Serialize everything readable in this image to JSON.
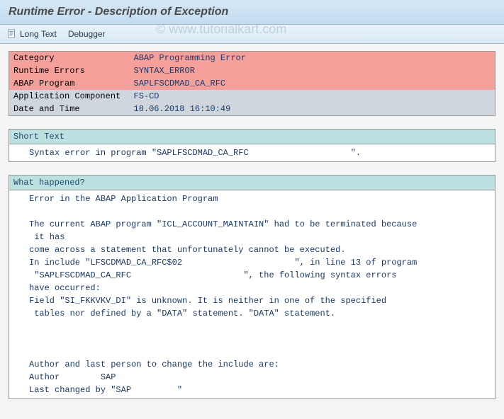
{
  "header": {
    "title": "Runtime Error - Description of Exception"
  },
  "toolbar": {
    "longtext_label": "Long Text",
    "debugger_label": "Debugger"
  },
  "info": {
    "rows": [
      {
        "label": "Category",
        "value": "ABAP Programming Error",
        "style": "red"
      },
      {
        "label": "Runtime Errors",
        "value": "SYNTAX_ERROR",
        "style": "red"
      },
      {
        "label": "ABAP Program",
        "value": "SAPLFSCDMAD_CA_RFC",
        "style": "red"
      },
      {
        "label": "Application Component",
        "value": "FS-CD",
        "style": "grey"
      },
      {
        "label": "Date and Time",
        "value": "18.06.2018 16:10:49",
        "style": "grey"
      }
    ]
  },
  "shorttext": {
    "header": "Short Text",
    "body": "Syntax error in program \"SAPLFSCDMAD_CA_RFC                    \"."
  },
  "whathappened": {
    "header": "What happened?",
    "body": "Error in the ABAP Application Program\n\nThe current ABAP program \"ICL_ACCOUNT_MAINTAIN\" had to be terminated because\n it has\ncome across a statement that unfortunately cannot be executed.\nIn include \"LFSCDMAD_CA_RFC$02                      \", in line 13 of program\n \"SAPLFSCDMAD_CA_RFC                      \", the following syntax errors\nhave occurred:\nField \"SI_FKKVKV_DI\" is unknown. It is neither in one of the specified\n tables nor defined by a \"DATA\" statement. \"DATA\" statement.\n\n\n\nAuthor and last person to change the include are:\nAuthor        SAP\nLast changed by \"SAP         \""
  },
  "watermark": "© www.tutorialkart.com"
}
